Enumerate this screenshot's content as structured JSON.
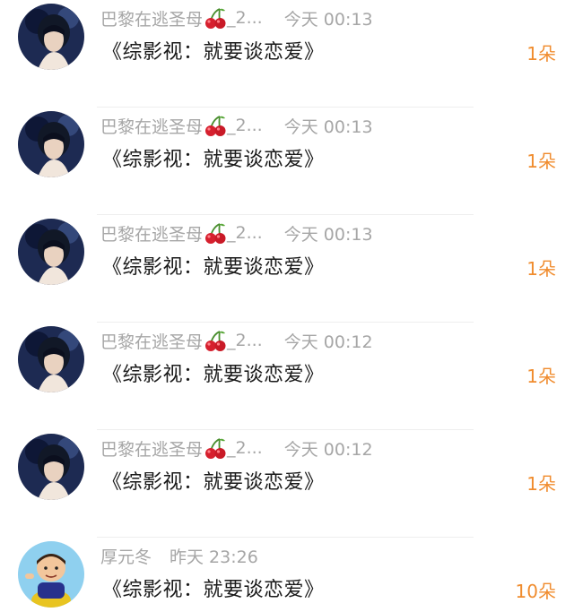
{
  "items": [
    {
      "name": "巴黎在逃圣母",
      "suffix": "_2...",
      "time": "今天 00:13",
      "title": "《综影视：就要谈恋爱》",
      "count": "1朵",
      "avatar": "girl-avatar"
    },
    {
      "name": "巴黎在逃圣母",
      "suffix": "_2...",
      "time": "今天 00:13",
      "title": "《综影视：就要谈恋爱》",
      "count": "1朵",
      "avatar": "girl-avatar"
    },
    {
      "name": "巴黎在逃圣母",
      "suffix": "_2...",
      "time": "今天 00:13",
      "title": "《综影视：就要谈恋爱》",
      "count": "1朵",
      "avatar": "girl-avatar"
    },
    {
      "name": "巴黎在逃圣母",
      "suffix": "_2...",
      "time": "今天 00:12",
      "title": "《综影视：就要谈恋爱》",
      "count": "1朵",
      "avatar": "girl-avatar"
    },
    {
      "name": "巴黎在逃圣母",
      "suffix": "_2...",
      "time": "今天 00:12",
      "title": "《综影视：就要谈恋爱》",
      "count": "1朵",
      "avatar": "girl-avatar"
    },
    {
      "name": "厚元冬",
      "suffix": "",
      "time": "昨天 23:26",
      "title": "《综影视：就要谈恋爱》",
      "count": "10朵",
      "avatar": "cartoon-avatar"
    }
  ],
  "colors": {
    "meta_text": "#a6a6a6",
    "title_text": "#1a1a1a",
    "count_text": "#f08c2e",
    "divider": "#eeeeee"
  }
}
